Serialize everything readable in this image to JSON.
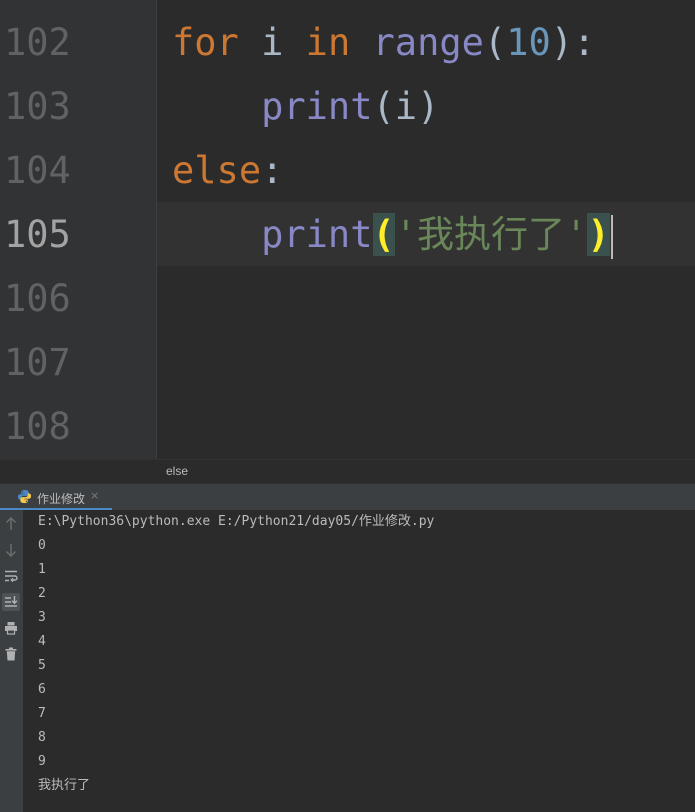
{
  "editor": {
    "line_numbers": [
      "102",
      "103",
      "104",
      "105",
      "106",
      "107",
      "108"
    ],
    "current_line": "105",
    "code": {
      "line_102": {
        "kw_for": "for",
        "var_i": "i",
        "kw_in": "in",
        "fn_range": "range",
        "paren_open": "(",
        "num": "10",
        "paren_close": ")",
        "colon": ":"
      },
      "line_103": {
        "indent": "    ",
        "fn_print": "print",
        "paren_open": "(",
        "arg": "i",
        "paren_close": ")"
      },
      "line_104": {
        "kw_else": "else",
        "colon": ":"
      },
      "line_105": {
        "indent": "    ",
        "fn_print": "print",
        "paren_open": "(",
        "string": "'我执行了'",
        "paren_close": ")"
      }
    }
  },
  "breadcrumb": {
    "text": "else"
  },
  "run_panel": {
    "tab_label": "作业修改",
    "tab_close": "×",
    "toolbar_icons": [
      "arrow-up-icon",
      "arrow-down-icon",
      "soft-wrap-icon",
      "scroll-to-end-icon",
      "print-icon",
      "trash-icon"
    ],
    "output": [
      "E:\\Python36\\python.exe E:/Python21/day05/作业修改.py",
      "0",
      "1",
      "2",
      "3",
      "4",
      "5",
      "6",
      "7",
      "8",
      "9",
      "我执行了"
    ]
  },
  "colors": {
    "keyword": "#cc7832",
    "builtin": "#8888c6",
    "number": "#6897bb",
    "string": "#6a8759",
    "brace_match": "#ffef28",
    "tab_underline": "#4a88c7"
  }
}
